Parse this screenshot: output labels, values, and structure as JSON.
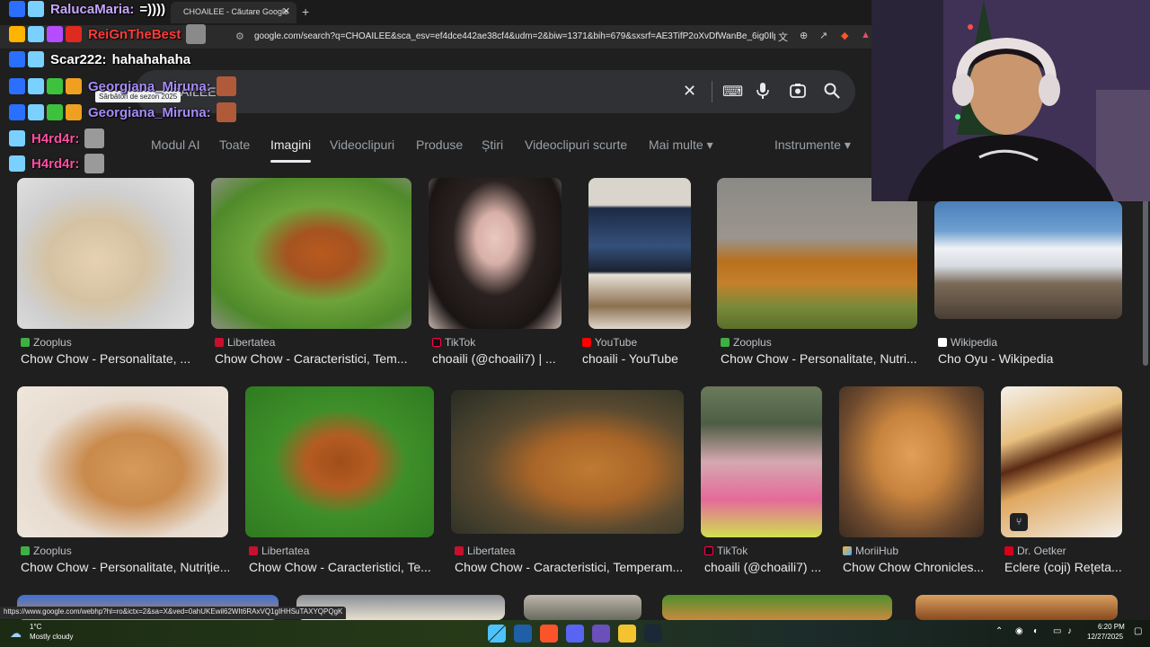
{
  "browser": {
    "tab_title": "CHOAILEE - Căutare Google",
    "tab_close": "✕",
    "new_tab": "+",
    "url": "google.com/search?q=CHOAILEE&sca_esv=ef4dce442ae38cf4&udm=2&biw=1371&bih=679&sxsrf=AE3TifP2oXvDfWanBe_6ig0IlpQHC0B...",
    "status_link": "https://www.google.com/webhp?hl=ro&ictx=2&sa=X&ved=0ahUKEwil62WIt6RAxVQ1gIHHSuTAXYQPQgK"
  },
  "search": {
    "query": "OAILEE",
    "clear_icon": "✕",
    "keyboard_icon": "⌨",
    "mic_icon": "🎤",
    "lens_icon": "◎",
    "search_icon": "⌕"
  },
  "tooltip": "Sărbători de sezon 2025",
  "tabs": [
    {
      "label": "Modul AI"
    },
    {
      "label": "Toate"
    },
    {
      "label": "Imagini"
    },
    {
      "label": "Videoclipuri"
    },
    {
      "label": "Produse"
    },
    {
      "label": "Știri"
    },
    {
      "label": "Videoclipuri scurte"
    },
    {
      "label": "Mai multe ▾"
    }
  ],
  "tools_label": "Instrumente ▾",
  "results_row1": [
    {
      "source": "Zooplus",
      "title": "Chow Chow - Personalitate, ..."
    },
    {
      "source": "Libertatea",
      "title": "Chow Chow - Caracteristici, Tem..."
    },
    {
      "source": "TikTok",
      "title": "choaili (@choaili7) | ..."
    },
    {
      "source": "YouTube",
      "title": "choaili - YouTube"
    },
    {
      "source": "Zooplus",
      "title": "Chow Chow - Personalitate, Nutri..."
    },
    {
      "source": "Wikipedia",
      "title": "Cho Oyu - Wikipedia"
    }
  ],
  "results_row2": [
    {
      "source": "Zooplus",
      "title": "Chow Chow - Personalitate, Nutriție..."
    },
    {
      "source": "Libertatea",
      "title": "Chow Chow - Caracteristici, Te..."
    },
    {
      "source": "Libertatea",
      "title": "Chow Chow - Caracteristici, Temperam..."
    },
    {
      "source": "TikTok",
      "title": "choaili (@choaili7) ..."
    },
    {
      "source": "MoriiHub",
      "title": "Chow Chow Chronicles..."
    },
    {
      "source": "Dr. Oetker",
      "title": "Eclere (coji) Rețeta..."
    }
  ],
  "chat": [
    {
      "user": "RalucaMaria:",
      "msg": "=))))",
      "color": "#c7a6ff"
    },
    {
      "user": "ReiGnTheBest",
      "msg": "",
      "color": "#ff3b3b"
    },
    {
      "user": "Scar222:",
      "msg": "hahahahaha",
      "color": "#ffffff"
    },
    {
      "user": "Georgiana_Miruna:",
      "msg": "",
      "color": "#a78bfa"
    },
    {
      "user": "Georgiana_Miruna:",
      "msg": "",
      "color": "#a78bfa"
    },
    {
      "user": "H4rd4r:",
      "msg": "",
      "color": "#ff4fa3"
    },
    {
      "user": "H4rd4r:",
      "msg": "",
      "color": "#ff4fa3"
    }
  ],
  "taskbar": {
    "temp": "1°C",
    "weather": "Mostly cloudy",
    "time": "6:20 PM",
    "date": "12/27/2025"
  }
}
